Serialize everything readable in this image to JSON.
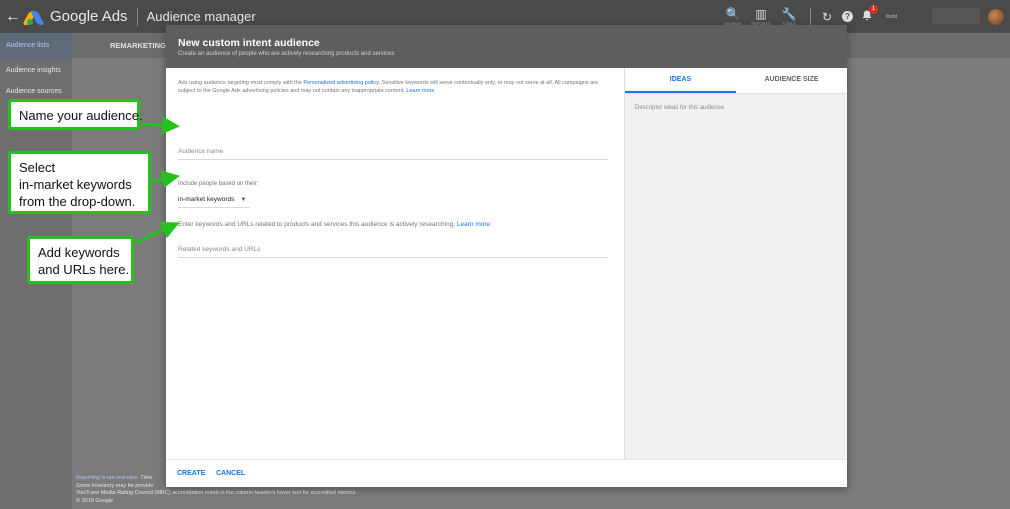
{
  "topbar": {
    "back_glyph": "←",
    "brand": "Google Ads",
    "page_title": "Audience manager",
    "tools": [
      {
        "icon": "search-icon",
        "glyph": "🔍",
        "caption": "SEARCH"
      },
      {
        "icon": "reports-icon",
        "glyph": "▥",
        "caption": "REPORTS"
      },
      {
        "icon": "wrench-icon",
        "glyph": "🔧",
        "caption": "TOOLS"
      }
    ],
    "refresh_glyph": "↻",
    "help_glyph": "?",
    "notification_count": "1",
    "account_text": "Ibebt"
  },
  "sidebar": {
    "items": [
      {
        "label": "Audience lists",
        "active": true
      },
      {
        "label": "Audience insights",
        "active": false
      },
      {
        "label": "Audience sources",
        "active": false
      }
    ]
  },
  "background": {
    "tab_label": "REMARKETING",
    "footer": {
      "line1_link": "Reporting is not real-time.",
      "line1_rest": " Time",
      "line2": "Some inventory may be provide",
      "line3": "You'll see Media Rating Council (MRC) accreditation noted in the column header's hover text for accredited metrics.",
      "line4": "© 2019 Google"
    }
  },
  "modal": {
    "title": "New custom intent audience",
    "subtitle": "Create an audience of people who are actively researching products and services",
    "policy_text_1": "Ads using audience targeting must comply with the ",
    "policy_link": "Personalized advertising policy",
    "policy_text_2": ". Sensitive keywords will serve contextually only, or may not serve at all. All campaigns are subject to the Google Ads advertising policies and may not contain any inappropriate content. ",
    "policy_learn_more": "Learn more",
    "audience_name_placeholder": "Audience name",
    "include_label": "Include people based on their:",
    "dropdown_value": "in-market keywords",
    "helper_text": "Enter keywords and URLs related to products and services this audience is actively researching. ",
    "helper_learn_more": "Learn more",
    "keywords_placeholder": "Related keywords and URLs",
    "panel": {
      "tabs": [
        {
          "label": "IDEAS",
          "active": true
        },
        {
          "label": "AUDIENCE SIZE",
          "active": false
        }
      ],
      "ideas_text": "Descriptor ideas for this audience"
    },
    "buttons": {
      "create": "CREATE",
      "cancel": "CANCEL"
    }
  },
  "callouts": {
    "c1": "Name your audience.",
    "c2_line1": "Select",
    "c2_line2": "in-market keywords",
    "c2_line3": "from the drop-down.",
    "c3_line1": "Add keywords",
    "c3_line2": "and URLs here."
  },
  "colors": {
    "accent": "#1a73e8",
    "callout_border": "#25c21f",
    "topbar": "#4a4a4a",
    "modal_header": "#5e5e5e"
  }
}
